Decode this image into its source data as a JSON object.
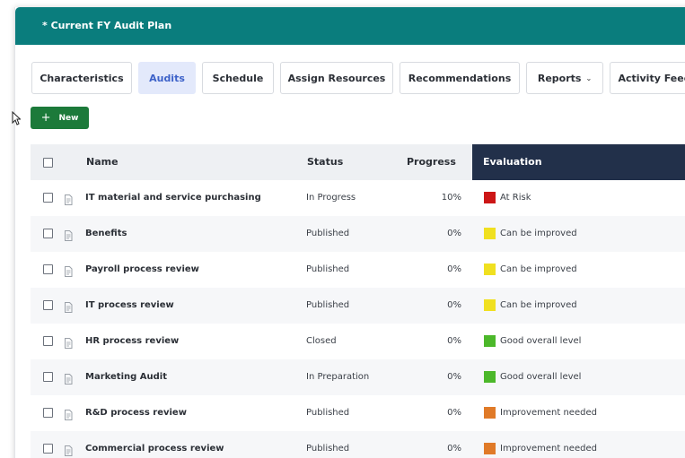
{
  "header": {
    "title": "* Current FY Audit Plan"
  },
  "tabs": [
    {
      "label": "Characteristics",
      "active": false
    },
    {
      "label": "Audits",
      "active": true
    },
    {
      "label": "Schedule",
      "active": false
    },
    {
      "label": "Assign Resources",
      "active": false
    },
    {
      "label": "Recommendations",
      "active": false
    },
    {
      "label": "Reports",
      "active": false,
      "dropdown": true
    },
    {
      "label": "Activity Feed",
      "active": false
    }
  ],
  "toolbar": {
    "new_label": "New"
  },
  "table": {
    "columns": {
      "name": "Name",
      "status": "Status",
      "progress": "Progress",
      "evaluation": "Evaluation"
    },
    "rows": [
      {
        "name": "IT material and service purchasing",
        "status": "In Progress",
        "progress": "10%",
        "evaluation": "At Risk",
        "eval_color": "#cc1616"
      },
      {
        "name": "Benefits",
        "status": "Published",
        "progress": "0%",
        "evaluation": "Can be improved",
        "eval_color": "#f0e020"
      },
      {
        "name": "Payroll process review",
        "status": "Published",
        "progress": "0%",
        "evaluation": "Can be improved",
        "eval_color": "#f0e020"
      },
      {
        "name": "IT process review",
        "status": "Published",
        "progress": "0%",
        "evaluation": "Can be improved",
        "eval_color": "#f0e020"
      },
      {
        "name": "HR process review",
        "status": "Closed",
        "progress": "0%",
        "evaluation": "Good overall level",
        "eval_color": "#4cb82a"
      },
      {
        "name": "Marketing Audit",
        "status": "In Preparation",
        "progress": "0%",
        "evaluation": "Good overall level",
        "eval_color": "#4cb82a"
      },
      {
        "name": "R&D process review",
        "status": "Published",
        "progress": "0%",
        "evaluation": "Improvement needed",
        "eval_color": "#e07a28"
      },
      {
        "name": "Commercial process review",
        "status": "Published",
        "progress": "0%",
        "evaluation": "Improvement needed",
        "eval_color": "#e07a28"
      }
    ]
  },
  "colors": {
    "header": "#0a7d7d",
    "new_button": "#1c7a3a",
    "evaluation_header": "#22304a",
    "active_tab": "#e3e9fb"
  },
  "icons": {
    "add": "plus-icon",
    "row_doc": "document-icon",
    "cursor": "mouse-pointer-icon",
    "dropdown": "chevron-down-icon"
  }
}
